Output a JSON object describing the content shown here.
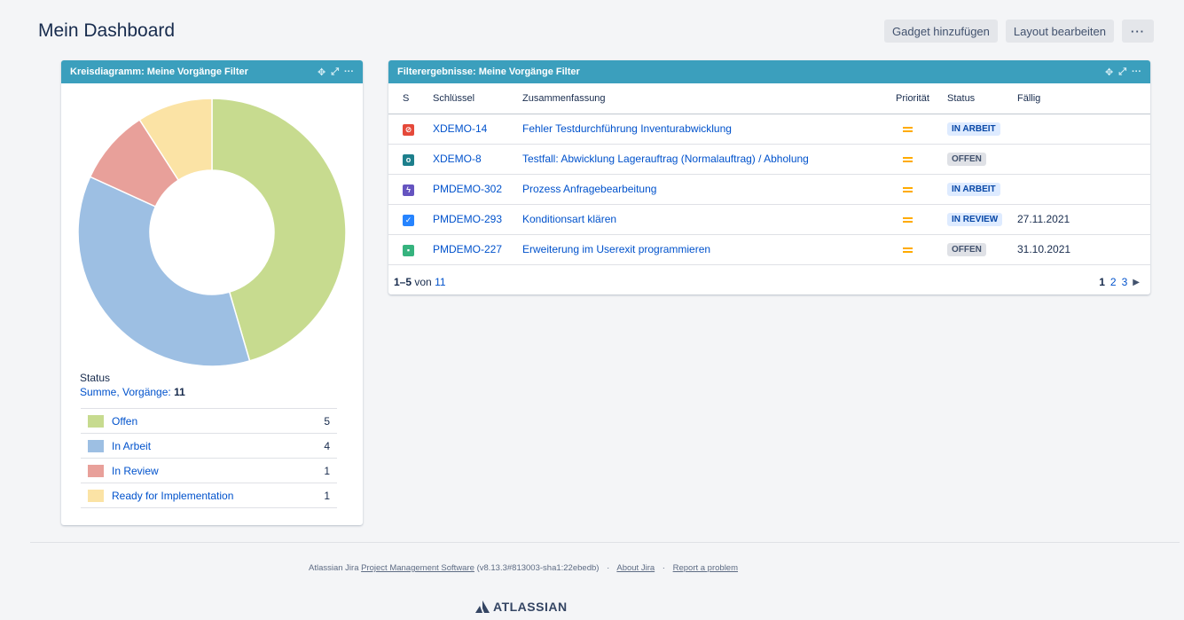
{
  "header": {
    "title": "Mein Dashboard",
    "add_gadget": "Gadget hinzufügen",
    "edit_layout": "Layout bearbeiten",
    "more": "···"
  },
  "pie_gadget": {
    "title": "Kreisdiagramm: Meine Vorgänge Filter",
    "status_label": "Status",
    "sum_label": "Summe, Vorgänge:",
    "sum_value": "11",
    "legend": [
      {
        "label": "Offen",
        "count": "5",
        "color": "#c7db8f"
      },
      {
        "label": "In Arbeit",
        "count": "4",
        "color": "#9dbfe3"
      },
      {
        "label": "In Review",
        "count": "1",
        "color": "#e8a09a"
      },
      {
        "label": "Ready for Implementation",
        "count": "1",
        "color": "#fbe3a5"
      }
    ]
  },
  "chart_data": {
    "type": "pie",
    "categories": [
      "Offen",
      "In Arbeit",
      "In Review",
      "Ready for Implementation"
    ],
    "values": [
      5,
      4,
      1,
      1
    ],
    "colors": [
      "#c7db8f",
      "#9dbfe3",
      "#e8a09a",
      "#fbe3a5"
    ],
    "donut": true,
    "title": "",
    "legend": "bottom"
  },
  "filter_gadget": {
    "title": "Filterergebnisse: Meine Vorgänge Filter",
    "columns": [
      "S",
      "Schlüssel",
      "Zusammenfassung",
      "Priorität",
      "Status",
      "Fällig"
    ],
    "rows": [
      {
        "type_icon": "blocker-icon",
        "type_color": "#e5493a",
        "type_glyph": "⊘",
        "key": "XDEMO-14",
        "summary": "Fehler Testdurchführung Inventurabwicklung",
        "status": "IN ARBEIT",
        "status_style": "blue",
        "due": ""
      },
      {
        "type_icon": "test-icon",
        "type_color": "#1d7f8c",
        "type_glyph": "o",
        "key": "XDEMO-8",
        "summary": "Testfall: Abwicklung Lagerauftrag (Normalauftrag) / Abholung",
        "status": "OFFEN",
        "status_style": "grey",
        "due": ""
      },
      {
        "type_icon": "epic-icon",
        "type_color": "#6554c0",
        "type_glyph": "ϟ",
        "key": "PMDEMO-302",
        "summary": "Prozess Anfragebearbeitung",
        "status": "IN ARBEIT",
        "status_style": "blue",
        "due": ""
      },
      {
        "type_icon": "task-icon",
        "type_color": "#2684ff",
        "type_glyph": "✓",
        "key": "PMDEMO-293",
        "summary": "Konditionsart klären",
        "status": "IN REVIEW",
        "status_style": "blue",
        "due": "27.11.2021"
      },
      {
        "type_icon": "story-icon",
        "type_color": "#36b37e",
        "type_glyph": "▪",
        "key": "PMDEMO-227",
        "summary": "Erweiterung im Userexit programmieren",
        "status": "OFFEN",
        "status_style": "grey",
        "due": "31.10.2021"
      }
    ],
    "pager": {
      "range": "1–5",
      "of": "von",
      "total": "11",
      "pages": [
        "1",
        "2",
        "3"
      ],
      "current": "1"
    }
  },
  "footer": {
    "prefix": "Atlassian Jira",
    "pm_link": "Project Management Software",
    "version": "(v8.13.3#813003-sha1:22ebedb)",
    "about": "About Jira",
    "report": "Report a problem",
    "sep": "·",
    "logo": "ATLASSIAN"
  }
}
